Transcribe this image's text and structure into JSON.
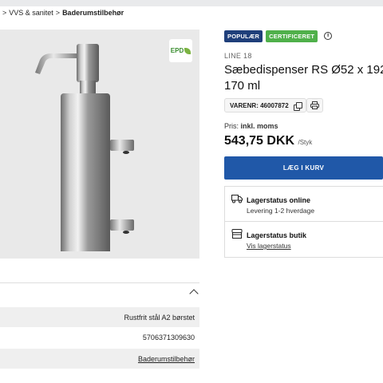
{
  "breadcrumb": {
    "items": [
      "VVS & sanitet",
      "Baderumstilbehør"
    ]
  },
  "product": {
    "badges": [
      "POPULÆR",
      "CERTIFICERET"
    ],
    "epd_badge": "EPD",
    "brand": "LINE 18",
    "title_line1": "Sæbedispenser RS Ø52 x 192",
    "title_line2": "170 ml",
    "varenr_label": "VARENR:",
    "varenr": "46007872",
    "price_label": "Pris:",
    "price_note": "inkl. moms",
    "price": "543,75 DKK",
    "price_unit": "/Styk"
  },
  "cart": {
    "button_label": "LÆG I KURV",
    "accent_color": "#2058a8"
  },
  "stock": {
    "online_title": "Lagerstatus online",
    "online_sub": "Levering 1-2 hverdage",
    "store_title": "Lagerstatus butik",
    "store_link": "Vis lagerstatus"
  },
  "specs": {
    "rows": [
      "Rustfrit stål A2 børstet",
      "5706371309630",
      "Baderumstilbehør"
    ]
  },
  "icons": {
    "info": "info-icon",
    "copy": "copy-icon",
    "print": "printer-icon",
    "truck": "truck-icon",
    "store": "store-icon",
    "chevron": "chevron-up-icon"
  }
}
